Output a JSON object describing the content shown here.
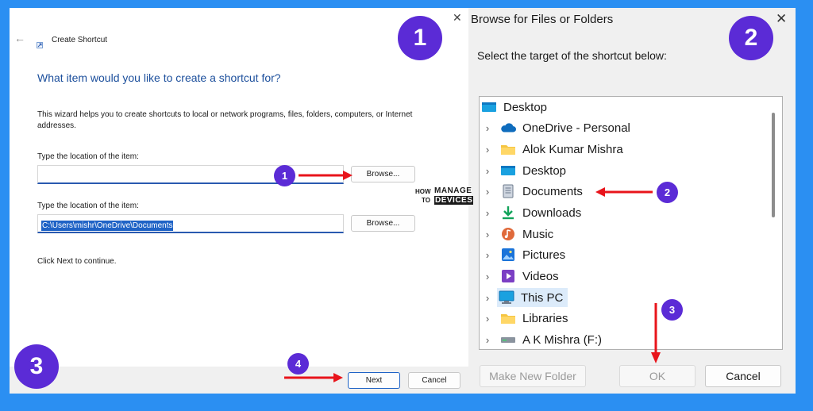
{
  "wizard": {
    "title": "Create Shortcut",
    "heading": "What item would you like to create a shortcut for?",
    "description": "This wizard helps you to create shortcuts to local or network programs, files, folders, computers, or Internet addresses.",
    "location_label_1": "Type the location of the item:",
    "location_value_1": "",
    "browse_label_1": "Browse...",
    "location_label_2": "Type the location of the item:",
    "location_value_2": "C:\\Users\\mishr\\OneDrive\\Documents",
    "browse_label_2": "Browse...",
    "hint": "Click Next to continue.",
    "next_label": "Next",
    "cancel_label": "Cancel",
    "close_glyph": "✕",
    "back_glyph": "←"
  },
  "browse": {
    "title": "Browse for Files or Folders",
    "instruction": "Select the target of the shortcut below:",
    "close_glyph": "✕",
    "tree": [
      {
        "label": "Desktop",
        "icon": "desktop-folder-icon",
        "expandable": false
      },
      {
        "label": "OneDrive - Personal",
        "icon": "onedrive-cloud-icon",
        "expandable": true
      },
      {
        "label": "Alok Kumar Mishra",
        "icon": "user-folder-icon",
        "expandable": true
      },
      {
        "label": "Desktop",
        "icon": "desktop-folder-icon",
        "expandable": true
      },
      {
        "label": "Documents",
        "icon": "documents-icon",
        "expandable": true
      },
      {
        "label": "Downloads",
        "icon": "download-icon",
        "expandable": true
      },
      {
        "label": "Music",
        "icon": "music-icon",
        "expandable": true
      },
      {
        "label": "Pictures",
        "icon": "pictures-icon",
        "expandable": true
      },
      {
        "label": "Videos",
        "icon": "videos-icon",
        "expandable": true
      },
      {
        "label": "This PC",
        "icon": "this-pc-icon",
        "expandable": true,
        "selected": true
      },
      {
        "label": "Libraries",
        "icon": "libraries-folder-icon",
        "expandable": true
      },
      {
        "label": "A K Mishra (F:)",
        "icon": "drive-icon",
        "expandable": true
      }
    ],
    "make_new_folder_label": "Make New Folder",
    "ok_label": "OK",
    "cancel_label": "Cancel"
  },
  "callouts": {
    "big_1": "1",
    "big_2": "2",
    "big_3": "3",
    "small_1": "1",
    "small_2": "2",
    "small_3": "3",
    "small_4": "4"
  },
  "watermark": {
    "how": "HOW",
    "to": "TO",
    "manage": "MANAGE",
    "devices": "DEVICES"
  },
  "colors": {
    "accent": "#5b2bd6",
    "arrow": "#e8141b",
    "background": "#2b8ff2",
    "heading": "#1c4f9c"
  }
}
